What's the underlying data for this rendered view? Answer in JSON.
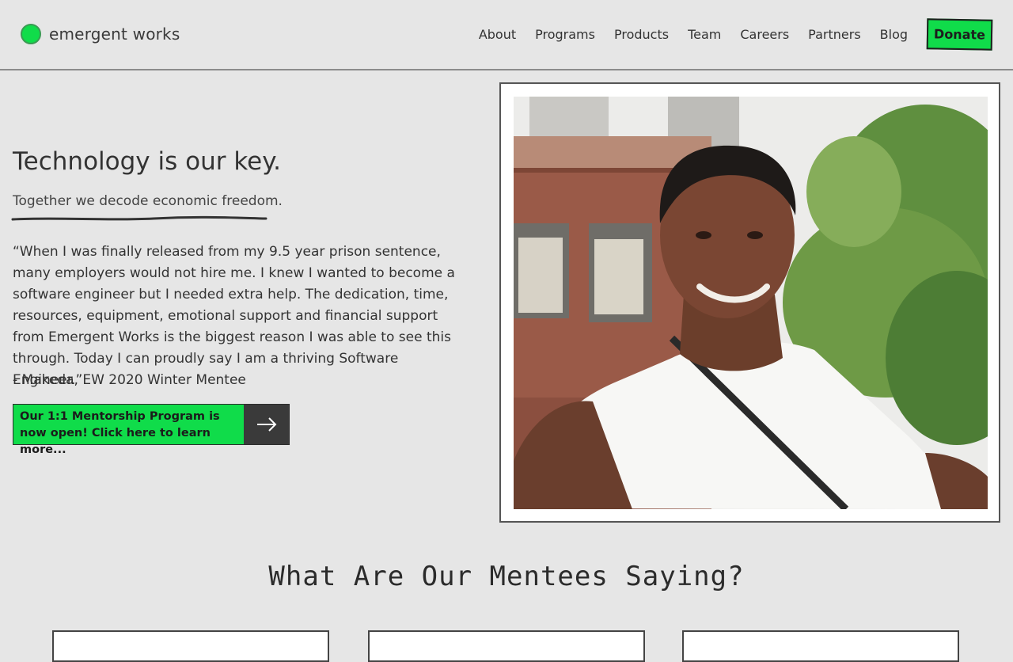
{
  "brand": {
    "name": "emergent works",
    "accent_color": "#10dc4a"
  },
  "nav": {
    "items": [
      "About",
      "Programs",
      "Products",
      "Team",
      "Careers",
      "Partners",
      "Blog"
    ],
    "donate_label": "Donate"
  },
  "hero": {
    "title": "Technology is our key.",
    "subtitle": "Together we decode economic freedom.",
    "quote": "“When I was finally released from my 9.5 year prison sentence, many employers would not hire me. I knew I wanted to become a software engineer but I needed extra help. The dedication, time, resources, equipment, emotional support and financial support from Emergent Works is the biggest reason I was able to see this through. Today I can proudly say I am a thriving Software Engineer.”",
    "attribution": "- Makeda, EW 2020 Winter Mentee",
    "cta_label": "Our 1:1 Mentorship Program is now open! Click here to learn more...",
    "cta_icon": "arrow-right-icon"
  },
  "photo": {
    "subject": "smiling-woman-outdoors-photo"
  },
  "mentees_section": {
    "title": "What Are Our Mentees Saying?"
  }
}
